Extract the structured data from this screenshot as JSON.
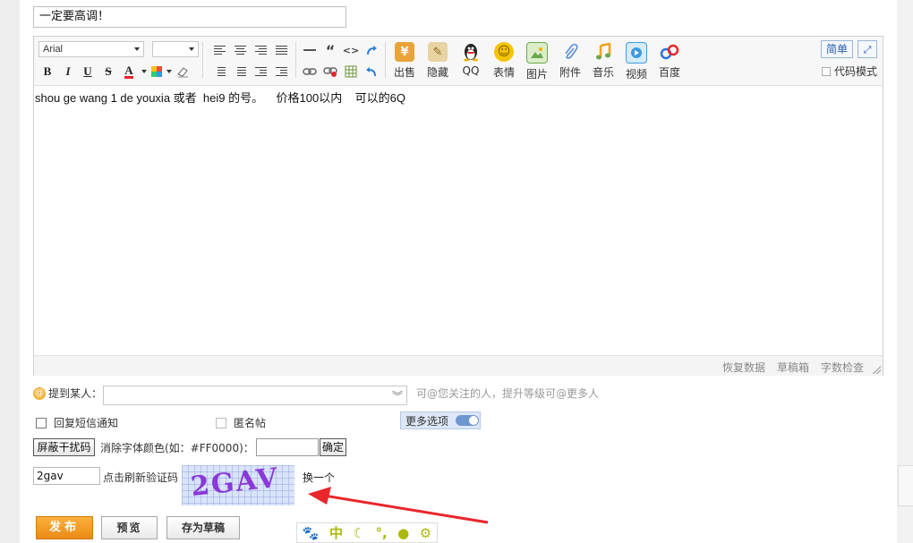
{
  "post": {
    "title": "一定要高调！",
    "content": "shou ge wang 1 de youxia 或者  hei9 的号。    价格100以内    可以的6Q"
  },
  "toolbar": {
    "font_family": "Arial",
    "font_size": "",
    "format_glyphs": {
      "bold": "B",
      "italic": "I",
      "underline": "U",
      "strike": "S",
      "font_color": "A",
      "quote": "“",
      "code": "<>"
    },
    "features": [
      {
        "id": "sell",
        "label": "出售",
        "icon": "sell-icon",
        "color": "#e8a33a"
      },
      {
        "id": "hide",
        "label": "隐藏",
        "icon": "hide-icon",
        "color": "#d9b25c"
      },
      {
        "id": "qq",
        "label": "QQ",
        "icon": "qq-penguin-icon",
        "color": "#222222"
      },
      {
        "id": "emoji",
        "label": "表情",
        "icon": "smiley-icon",
        "color": "#f5c400"
      },
      {
        "id": "image",
        "label": "图片",
        "icon": "image-icon",
        "color": "#6aa84f"
      },
      {
        "id": "attach",
        "label": "附件",
        "icon": "paperclip-icon",
        "color": "#5b8dd6"
      },
      {
        "id": "music",
        "label": "音乐",
        "icon": "music-icon",
        "color": "#f0a21a"
      },
      {
        "id": "video",
        "label": "视频",
        "icon": "video-icon",
        "color": "#3d9be0"
      },
      {
        "id": "baidu",
        "label": "百度",
        "icon": "baidu-icon",
        "color": "#2f6fd6"
      }
    ],
    "simple_mode": "简单",
    "code_mode": "代码模式"
  },
  "statusbar": {
    "restore": "恢复数据",
    "drafts": "草稿箱",
    "word_count": "字数检查"
  },
  "mention": {
    "label": "提到某人：",
    "hint": "可@您关注的人，提升等级可@更多人"
  },
  "options": {
    "reply_sms": "回复短信通知",
    "anonymous": "匿名帖",
    "more": "更多选项"
  },
  "filter": {
    "block_button": "屏蔽干扰码",
    "clear_color_label": "消除字体颜色(如：#FF0000)：",
    "color_value": "",
    "confirm": "确定"
  },
  "captcha": {
    "value": "2gav",
    "refresh_hint": "点击刷新验证码",
    "image_text": "2GAV",
    "change": "换一个"
  },
  "actions": {
    "publish": "发布",
    "preview": "预览",
    "save_draft": "存为草稿"
  },
  "ime": {
    "mode": "中"
  },
  "colors": {
    "accent_orange": "#ef8f1a",
    "link_blue": "#2a5aa8",
    "annotation_red": "#e8262b",
    "captcha_purple": "#8a38d8"
  }
}
